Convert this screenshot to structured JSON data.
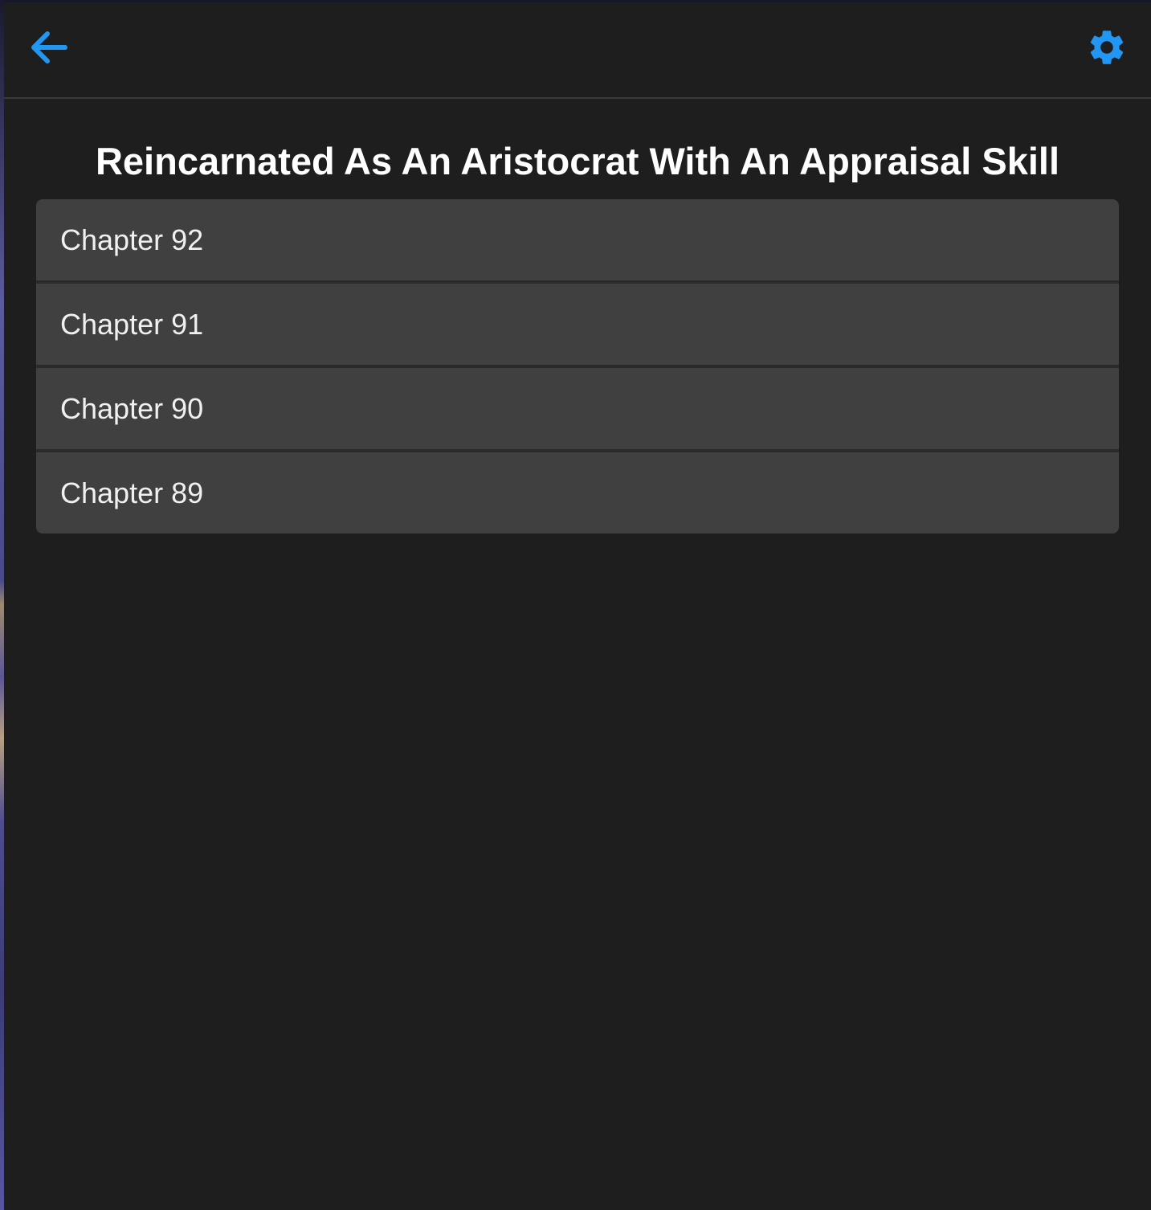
{
  "header": {
    "back_icon": "arrow-left-icon",
    "settings_icon": "gear-icon",
    "accent_color": "#2196f3"
  },
  "manga": {
    "title": "Reincarnated As An Aristocrat With An Appraisal Skill"
  },
  "chapters": [
    {
      "label": "Chapter 92"
    },
    {
      "label": "Chapter 91"
    },
    {
      "label": "Chapter 90"
    },
    {
      "label": "Chapter 89"
    }
  ],
  "colors": {
    "background": "#1e1e1e",
    "item_background": "#404040",
    "text": "#ffffff"
  }
}
